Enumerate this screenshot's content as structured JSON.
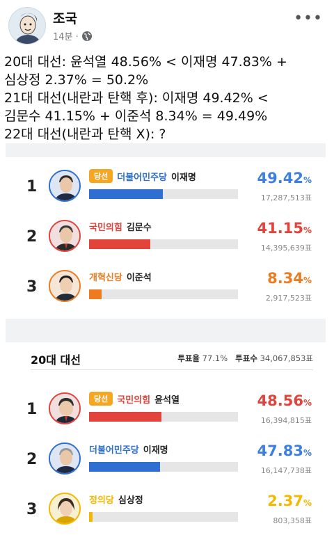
{
  "author": "조국",
  "time": "14분 ·",
  "post_lines": [
    "20대 대선: 윤석열 48.56% < 이재명 47.83% +",
    "심상정 2.37% = 50.2%",
    "21대 대선(내란과 탄핵 후): 이재명 49.42% <",
    "김문수 41.15% + 이준석 8.34% = 49.49%",
    "22대 대선(내란과 탄핵 X): ?"
  ],
  "colors": {
    "democratic": "#2f6fd1",
    "ppp": "#e2443c",
    "reform": "#ee7b1f",
    "justice": "#f5b800",
    "win": "#f5a623"
  },
  "card21": {
    "rows": [
      {
        "rank": "1",
        "badge": "당선",
        "party": "더불어민주당",
        "name": "이재명",
        "pct": "49.42",
        "unit": "%",
        "votes": "17,287,513표",
        "share": 0.4942,
        "color": "#2f6fd1",
        "pct_color": "#3d7fe0"
      },
      {
        "rank": "2",
        "party": "국민의힘",
        "name": "김문수",
        "pct": "41.15",
        "unit": "%",
        "votes": "14,395,639표",
        "share": 0.4115,
        "color": "#e2443c",
        "pct_color": "#e2443c"
      },
      {
        "rank": "3",
        "party": "개혁신당",
        "name": "이준석",
        "pct": "8.34",
        "unit": "%",
        "votes": "2,917,523표",
        "share": 0.0834,
        "color": "#ee7b1f",
        "pct_color": "#ee7b1f"
      }
    ]
  },
  "card20": {
    "title": "20대 대선",
    "turnout_label": "투표율",
    "turnout": "77.1%",
    "total_label": "투표수",
    "total": "34,067,853표",
    "rows": [
      {
        "rank": "1",
        "badge": "당선",
        "party": "국민의힘",
        "name": "윤석열",
        "pct": "48.56",
        "unit": "%",
        "votes": "16,394,815표",
        "share": 0.4856,
        "color": "#e2443c",
        "pct_color": "#e2443c"
      },
      {
        "rank": "2",
        "party": "더불어민주당",
        "name": "이재명",
        "pct": "47.83",
        "unit": "%",
        "votes": "16,147,738표",
        "share": 0.4783,
        "color": "#2f6fd1",
        "pct_color": "#3d7fe0"
      },
      {
        "rank": "3",
        "party": "정의당",
        "name": "심상정",
        "pct": "2.37",
        "unit": "%",
        "votes": "803,358표",
        "share": 0.0237,
        "color": "#f5b800",
        "pct_color": "#f5b800"
      }
    ]
  }
}
